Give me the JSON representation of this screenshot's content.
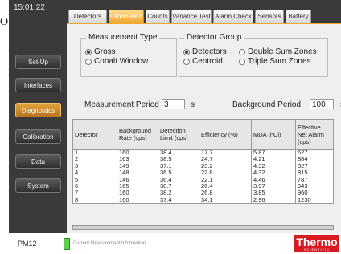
{
  "stray_mark": "O",
  "clock": "15:01:22",
  "nav": [
    "Set-Up",
    "Interfaces",
    "Diagnostics",
    "Calibration",
    "Data",
    "System"
  ],
  "nav_active": "Diagnostics",
  "tabs": [
    "Detectors",
    "Information",
    "Counts",
    "Variance Test",
    "Alarm Check",
    "Sensors",
    "Battery"
  ],
  "tab_active": "Information",
  "measurement_type": {
    "title": "Measurement Type",
    "options": [
      "Gross",
      "Cobalt Window"
    ],
    "selected": "Gross"
  },
  "detector_group": {
    "title": "Detector Group",
    "options": [
      "Detectors",
      "Double Sum Zones",
      "Centroid",
      "Triple Sum Zones"
    ],
    "selected": "Detectors"
  },
  "measurement_period": {
    "label": "Measurement Period",
    "value": "3",
    "unit": "s"
  },
  "background_period": {
    "label": "Background Period",
    "value": "100",
    "unit": "s"
  },
  "table": {
    "headers": [
      "Detector",
      "Background Rate (cps)",
      "Detection Limit (cps)",
      "Efficiency (%)",
      "MDA (nCi)",
      "Effective Net Alarm (cps)"
    ],
    "rows": [
      [
        "1",
        "160",
        "38.4",
        "17.7",
        "5.87",
        "627"
      ],
      [
        "2",
        "163",
        "38.5",
        "24.7",
        "4.21",
        "884"
      ],
      [
        "3",
        "149",
        "37.1",
        "23.2",
        "4.32",
        "827"
      ],
      [
        "4",
        "148",
        "36.5",
        "22.8",
        "4.32",
        "815"
      ],
      [
        "5",
        "146",
        "36.4",
        "22.1",
        "4.46",
        "787"
      ],
      [
        "6",
        "165",
        "38.7",
        "26.4",
        "3.97",
        "943"
      ],
      [
        "7",
        "160",
        "38.2",
        "26.8",
        "3.85",
        "960"
      ],
      [
        "8",
        "160",
        "37.4",
        "34.1",
        "2.96",
        "1230"
      ]
    ]
  },
  "status": {
    "device": "PM12",
    "message": "Current Measurement Information",
    "brand": "Thermo",
    "brand_sub": "SCIENTIFIC"
  },
  "colors": {
    "accent": "#f0a830",
    "brand": "#d71920",
    "chrome": "#3a3a3a",
    "battery": "#5bd14a"
  }
}
